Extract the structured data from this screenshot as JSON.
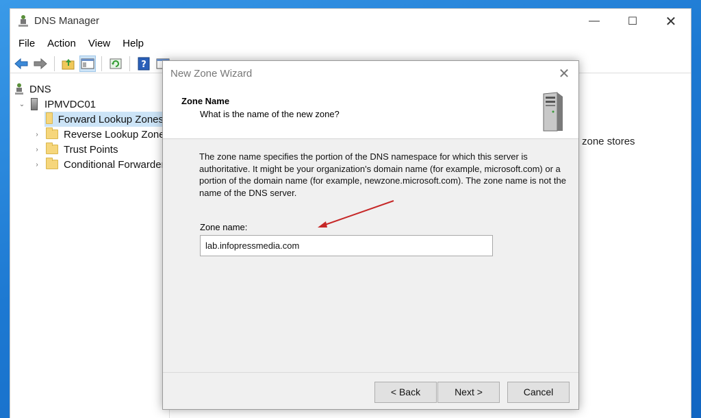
{
  "window": {
    "title": "DNS Manager",
    "minimize": "—",
    "maximize": "☐",
    "close": "✕"
  },
  "menu": [
    "File",
    "Action",
    "View",
    "Help"
  ],
  "toolbar": [
    "back-arrow-icon",
    "forward-arrow-icon",
    "folder-up-icon",
    "show-hide-tree-icon",
    "refresh-icon",
    "help-icon",
    "console-icon"
  ],
  "tree": {
    "root": "DNS",
    "server": "IPMVDC01",
    "items": [
      "Forward Lookup Zones",
      "Reverse Lookup Zones",
      "Trust Points",
      "Conditional Forwarders"
    ]
  },
  "right_pane": {
    "text": "zone stores"
  },
  "dialog": {
    "title": "New Zone Wizard",
    "close": "✕",
    "heading": "Zone Name",
    "subheading": "What is the name of the new zone?",
    "description": "The zone name specifies the portion of the DNS namespace for which this server is authoritative. It might be your organization's domain name (for example,  microsoft.com) or a portion of the domain name (for example, newzone.microsoft.com). The zone name is not the name of the DNS server.",
    "zone_label": "Zone name:",
    "zone_value": "lab.infopressmedia.com",
    "buttons": {
      "back": "< Back",
      "next": "Next >",
      "cancel": "Cancel"
    }
  },
  "colors": {
    "desktop": "#1d79d2",
    "selection": "#cce4f7",
    "arrow": "#c62828"
  }
}
